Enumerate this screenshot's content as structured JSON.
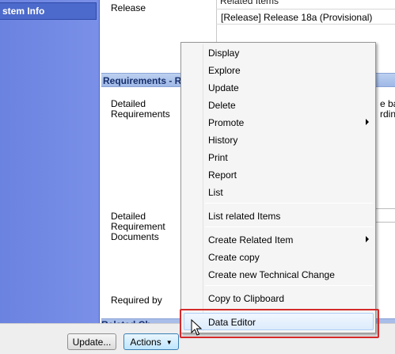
{
  "sidebar": {
    "header": "stem Info"
  },
  "main": {
    "release_label": "Release",
    "related_items_header": "Related Items",
    "release_value": "[Release] Release 18a (Provisional)",
    "section_requirements": "Requirements - R",
    "detailed_requirements_label": [
      "Detailed",
      "Requirements"
    ],
    "right_snippet": [
      "e bac",
      "rdingl"
    ],
    "detailed_requirement_documents_label": [
      "Detailed",
      "Requirement",
      "Documents"
    ],
    "required_by_label": "Required by",
    "section_related": "Related Ch"
  },
  "buttons": {
    "update": "Update...",
    "actions": "Actions",
    "actions_arrow": "▼"
  },
  "menu": {
    "items": [
      {
        "label": "Display",
        "submenu": false
      },
      {
        "label": "Explore",
        "submenu": false
      },
      {
        "label": "Update",
        "submenu": false
      },
      {
        "label": "Delete",
        "submenu": false
      },
      {
        "label": "Promote",
        "submenu": true
      },
      {
        "label": "History",
        "submenu": false
      },
      {
        "label": "Print",
        "submenu": false
      },
      {
        "label": "Report",
        "submenu": false
      },
      {
        "label": "List",
        "submenu": false
      },
      {
        "label": "List related Items",
        "submenu": false
      },
      {
        "label": "Create Related Item",
        "submenu": true
      },
      {
        "label": "Create copy",
        "submenu": false
      },
      {
        "label": "Create new Technical Change",
        "submenu": false
      },
      {
        "label": "Copy to Clipboard",
        "submenu": false
      },
      {
        "label": "Data Editor",
        "submenu": false,
        "hovered": true
      }
    ]
  },
  "colors": {
    "sidebar": "#6b83e0",
    "section_bar": "#a8bde8",
    "highlight": "#d42b2b"
  }
}
